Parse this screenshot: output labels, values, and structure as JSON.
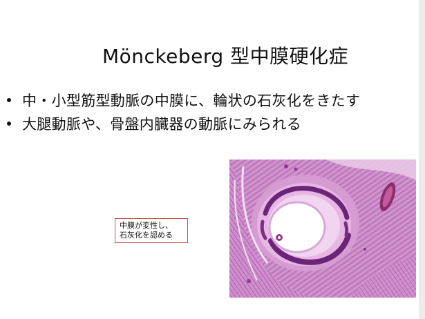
{
  "slide": {
    "title": "Mönckeberg 型中膜硬化症",
    "bullets": [
      "中・小型筋型動脈の中膜に、輪状の石灰化をきたす",
      "大腿動脈や、骨盤内臓器の動脈にみられる"
    ],
    "callout": {
      "line1": "中膜が変性し、",
      "line2": "石灰化を認める",
      "border_color": "#c0504d"
    },
    "image": {
      "subject": "histology-micrograph",
      "stain_colors": {
        "background": "#c98bc7",
        "tissue": "#e7b6e4",
        "calcification": "#6b2577",
        "lumen": "#ffffff"
      }
    }
  }
}
